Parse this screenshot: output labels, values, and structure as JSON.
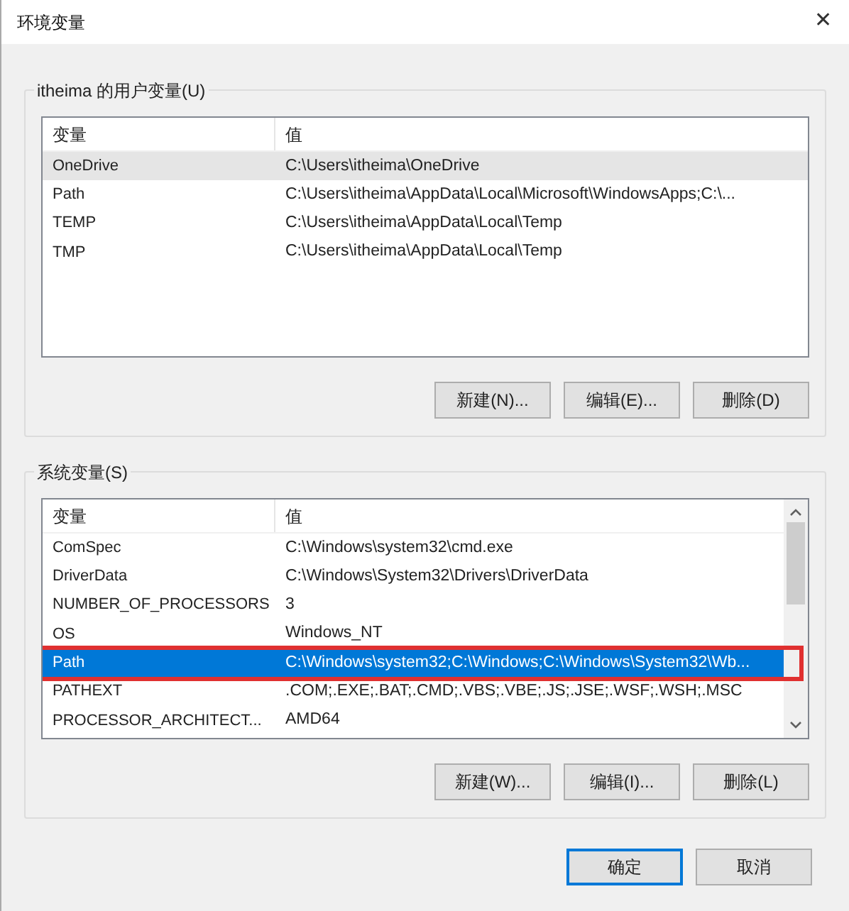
{
  "window": {
    "title": "环境变量",
    "close": "✕"
  },
  "user_vars": {
    "label": "itheima 的用户变量(U)",
    "focused": false,
    "columns": [
      "变量",
      "值"
    ],
    "rows": [
      {
        "name": "OneDrive",
        "value": "C:\\Users\\itheima\\OneDrive",
        "selected": true,
        "annotated": false
      },
      {
        "name": "Path",
        "value": "C:\\Users\\itheima\\AppData\\Local\\Microsoft\\WindowsApps;C:\\...",
        "selected": false,
        "annotated": false
      },
      {
        "name": "TEMP",
        "value": "C:\\Users\\itheima\\AppData\\Local\\Temp",
        "selected": false,
        "annotated": false
      },
      {
        "name": "TMP",
        "value": "C:\\Users\\itheima\\AppData\\Local\\Temp",
        "selected": false,
        "annotated": false
      }
    ],
    "buttons": [
      "新建(N)...",
      "编辑(E)...",
      "删除(D)"
    ]
  },
  "system_vars": {
    "label": "系统变量(S)",
    "focused": true,
    "columns": [
      "变量",
      "值"
    ],
    "rows": [
      {
        "name": "ComSpec",
        "value": "C:\\Windows\\system32\\cmd.exe",
        "selected": false,
        "annotated": false
      },
      {
        "name": "DriverData",
        "value": "C:\\Windows\\System32\\Drivers\\DriverData",
        "selected": false,
        "annotated": false
      },
      {
        "name": "NUMBER_OF_PROCESSORS",
        "value": "3",
        "selected": false,
        "annotated": false
      },
      {
        "name": "OS",
        "value": "Windows_NT",
        "selected": false,
        "annotated": false
      },
      {
        "name": "Path",
        "value": "C:\\Windows\\system32;C:\\Windows;C:\\Windows\\System32\\Wb...",
        "selected": true,
        "annotated": true
      },
      {
        "name": "PATHEXT",
        "value": ".COM;.EXE;.BAT;.CMD;.VBS;.VBE;.JS;.JSE;.WSF;.WSH;.MSC",
        "selected": false,
        "annotated": false
      },
      {
        "name": "PROCESSOR_ARCHITECT...",
        "value": "AMD64",
        "selected": false,
        "annotated": false
      }
    ],
    "buttons": [
      "新建(W)...",
      "编辑(I)...",
      "删除(L)"
    ]
  },
  "footer": {
    "buttons": [
      {
        "label": "确定",
        "default": true
      },
      {
        "label": "取消",
        "default": false
      }
    ]
  }
}
